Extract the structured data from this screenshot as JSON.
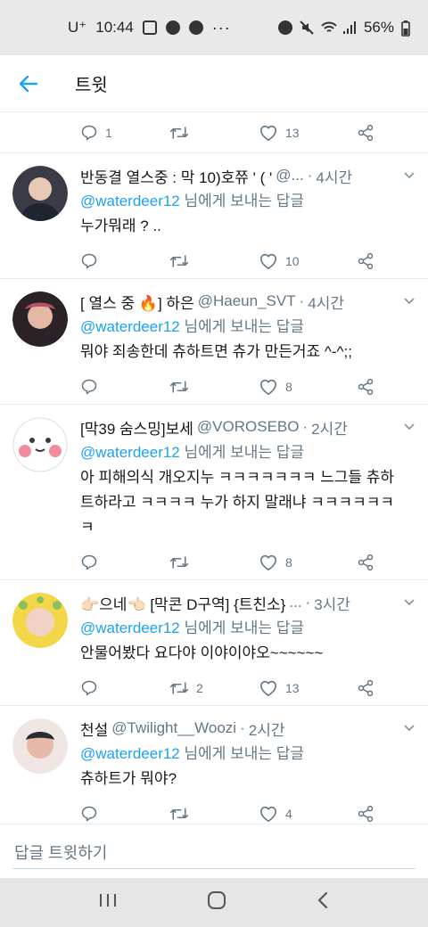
{
  "status": {
    "carrier": "U⁺",
    "time": "10:44",
    "more": "···",
    "battery": "56%"
  },
  "header": {
    "title": "트윗"
  },
  "top_actions": {
    "replies": "1",
    "retweets": "",
    "likes": "13"
  },
  "tweets": [
    {
      "name": "반동결 열스중 : 막 10)호쮸 ' ( '",
      "handle": "@...",
      "time": "4시간",
      "reply_mention": "@waterdeer12",
      "reply_suffix": " 님에게 보내는 답글",
      "text": "누가뭐래 ? ..",
      "replies": "",
      "retweets": "",
      "likes": "10",
      "avatar_colors": [
        "#3b3b48",
        "#e8c9b6",
        "#1f2430"
      ]
    },
    {
      "name": "[ 열스 중 🔥] 하은",
      "handle": "@Haeun_SVT",
      "time": "4시간",
      "reply_mention": "@waterdeer12",
      "reply_suffix": " 님에게 보내는 답글",
      "text": "뭐야 죄송한데 츄하트면 츄가 만든거죠 ^-^;;",
      "replies": "",
      "retweets": "",
      "likes": "8",
      "avatar_colors": [
        "#2a2226",
        "#e4b7a5",
        "#b9506a"
      ]
    },
    {
      "name": "[막39 숨스밍]보세",
      "handle": "@VOROSEBO",
      "time": "2시간",
      "reply_mention": "@waterdeer12",
      "reply_suffix": " 님에게 보내는 답글",
      "text": "아 피해의식 개오지누 ㅋㅋㅋㅋㅋㅋㅋ 느그들 츄하트하라고 ㅋㅋㅋㅋ 누가 하지 말래냐 ㅋㅋㅋㅋㅋㅋㅋ",
      "replies": "",
      "retweets": "",
      "likes": "8",
      "avatar_colors": [
        "#ffffff",
        "#f28b9b",
        "#3a3a3a"
      ]
    },
    {
      "name": "👉🏻으네👈🏻 [막콘 D구역] {트친소}",
      "handle": "...",
      "time": "3시간",
      "reply_mention": "@waterdeer12",
      "reply_suffix": " 님에게 보내는 답글",
      "text": "안물어봤다 요다야 이야이야오~~~~~~",
      "replies": "",
      "retweets": "2",
      "likes": "13",
      "avatar_colors": [
        "#f3d64a",
        "#f0d3c4",
        "#8bbf5a"
      ]
    },
    {
      "name": "천설",
      "handle": "@Twilight__Woozi",
      "time": "2시간",
      "reply_mention": "@waterdeer12",
      "reply_suffix": " 님에게 보내는 답글",
      "text": "츄하트가 뭐야?",
      "replies": "",
      "retweets": "",
      "likes": "4",
      "avatar_colors": [
        "#efe6e3",
        "#e7b9a8",
        "#2b2b33"
      ]
    }
  ],
  "reply_bar": {
    "placeholder": "답글 트윗하기"
  },
  "colors": {
    "accent": "#1da1f2",
    "secondary_text": "#657786",
    "divider": "#e6ecf0"
  }
}
